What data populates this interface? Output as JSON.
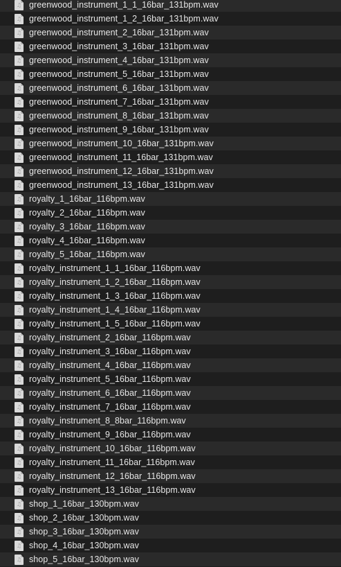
{
  "files": [
    {
      "name": "greenwood_instrument_1_1_16bar_131bpm.wav",
      "icon": "audio-file-icon"
    },
    {
      "name": "greenwood_instrument_1_2_16bar_131bpm.wav",
      "icon": "audio-file-icon"
    },
    {
      "name": "greenwood_instrument_2_16bar_131bpm.wav",
      "icon": "audio-file-icon"
    },
    {
      "name": "greenwood_instrument_3_16bar_131bpm.wav",
      "icon": "audio-file-icon"
    },
    {
      "name": "greenwood_instrument_4_16bar_131bpm.wav",
      "icon": "audio-file-icon"
    },
    {
      "name": "greenwood_instrument_5_16bar_131bpm.wav",
      "icon": "audio-file-icon"
    },
    {
      "name": "greenwood_instrument_6_16bar_131bpm.wav",
      "icon": "audio-file-icon"
    },
    {
      "name": "greenwood_instrument_7_16bar_131bpm.wav",
      "icon": "audio-file-icon"
    },
    {
      "name": "greenwood_instrument_8_16bar_131bpm.wav",
      "icon": "audio-file-icon"
    },
    {
      "name": "greenwood_instrument_9_16bar_131bpm.wav",
      "icon": "audio-file-icon"
    },
    {
      "name": "greenwood_instrument_10_16bar_131bpm.wav",
      "icon": "audio-file-icon"
    },
    {
      "name": "greenwood_instrument_11_16bar_131bpm.wav",
      "icon": "audio-file-icon"
    },
    {
      "name": "greenwood_instrument_12_16bar_131bpm.wav",
      "icon": "audio-file-icon"
    },
    {
      "name": "greenwood_instrument_13_16bar_131bpm.wav",
      "icon": "audio-file-icon"
    },
    {
      "name": "royalty_1_16bar_116bpm.wav",
      "icon": "audio-file-icon"
    },
    {
      "name": "royalty_2_16bar_116bpm.wav",
      "icon": "audio-file-icon"
    },
    {
      "name": "royalty_3_16bar_116bpm.wav",
      "icon": "audio-file-icon"
    },
    {
      "name": "royalty_4_16bar_116bpm.wav",
      "icon": "audio-file-icon"
    },
    {
      "name": "royalty_5_16bar_116bpm.wav",
      "icon": "audio-file-icon"
    },
    {
      "name": "royalty_instrument_1_1_16bar_116bpm.wav",
      "icon": "audio-file-icon"
    },
    {
      "name": "royalty_instrument_1_2_16bar_116bpm.wav",
      "icon": "audio-file-icon"
    },
    {
      "name": "royalty_instrument_1_3_16bar_116bpm.wav",
      "icon": "audio-file-icon"
    },
    {
      "name": "royalty_instrument_1_4_16bar_116bpm.wav",
      "icon": "audio-file-icon"
    },
    {
      "name": "royalty_instrument_1_5_16bar_116bpm.wav",
      "icon": "audio-file-icon"
    },
    {
      "name": "royalty_instrument_2_16bar_116bpm.wav",
      "icon": "audio-file-icon"
    },
    {
      "name": "royalty_instrument_3_16bar_116bpm.wav",
      "icon": "audio-file-icon"
    },
    {
      "name": "royalty_instrument_4_16bar_116bpm.wav",
      "icon": "audio-file-icon"
    },
    {
      "name": "royalty_instrument_5_16bar_116bpm.wav",
      "icon": "audio-file-icon"
    },
    {
      "name": "royalty_instrument_6_16bar_116bpm.wav",
      "icon": "audio-file-icon"
    },
    {
      "name": "royalty_instrument_7_16bar_116bpm.wav",
      "icon": "audio-file-icon"
    },
    {
      "name": "royalty_instrument_8_8bar_116bpm.wav",
      "icon": "audio-file-icon"
    },
    {
      "name": "royalty_instrument_9_16bar_116bpm.wav",
      "icon": "audio-file-icon"
    },
    {
      "name": "royalty_instrument_10_16bar_116bpm.wav",
      "icon": "audio-file-icon"
    },
    {
      "name": "royalty_instrument_11_16bar_116bpm.wav",
      "icon": "audio-file-icon"
    },
    {
      "name": "royalty_instrument_12_16bar_116bpm.wav",
      "icon": "audio-file-icon"
    },
    {
      "name": "royalty_instrument_13_16bar_116bpm.wav",
      "icon": "audio-file-icon"
    },
    {
      "name": "shop_1_16bar_130bpm.wav",
      "icon": "audio-file-icon"
    },
    {
      "name": "shop_2_16bar_130bpm.wav",
      "icon": "audio-file-icon"
    },
    {
      "name": "shop_3_16bar_130bpm.wav",
      "icon": "audio-file-icon"
    },
    {
      "name": "shop_4_16bar_130bpm.wav",
      "icon": "audio-file-icon"
    },
    {
      "name": "shop_5_16bar_130bpm.wav",
      "icon": "audio-file-icon"
    }
  ],
  "colors": {
    "background": "#1e1e1e",
    "stripe": "#2a2a2a",
    "text": "#e6e6e6"
  }
}
